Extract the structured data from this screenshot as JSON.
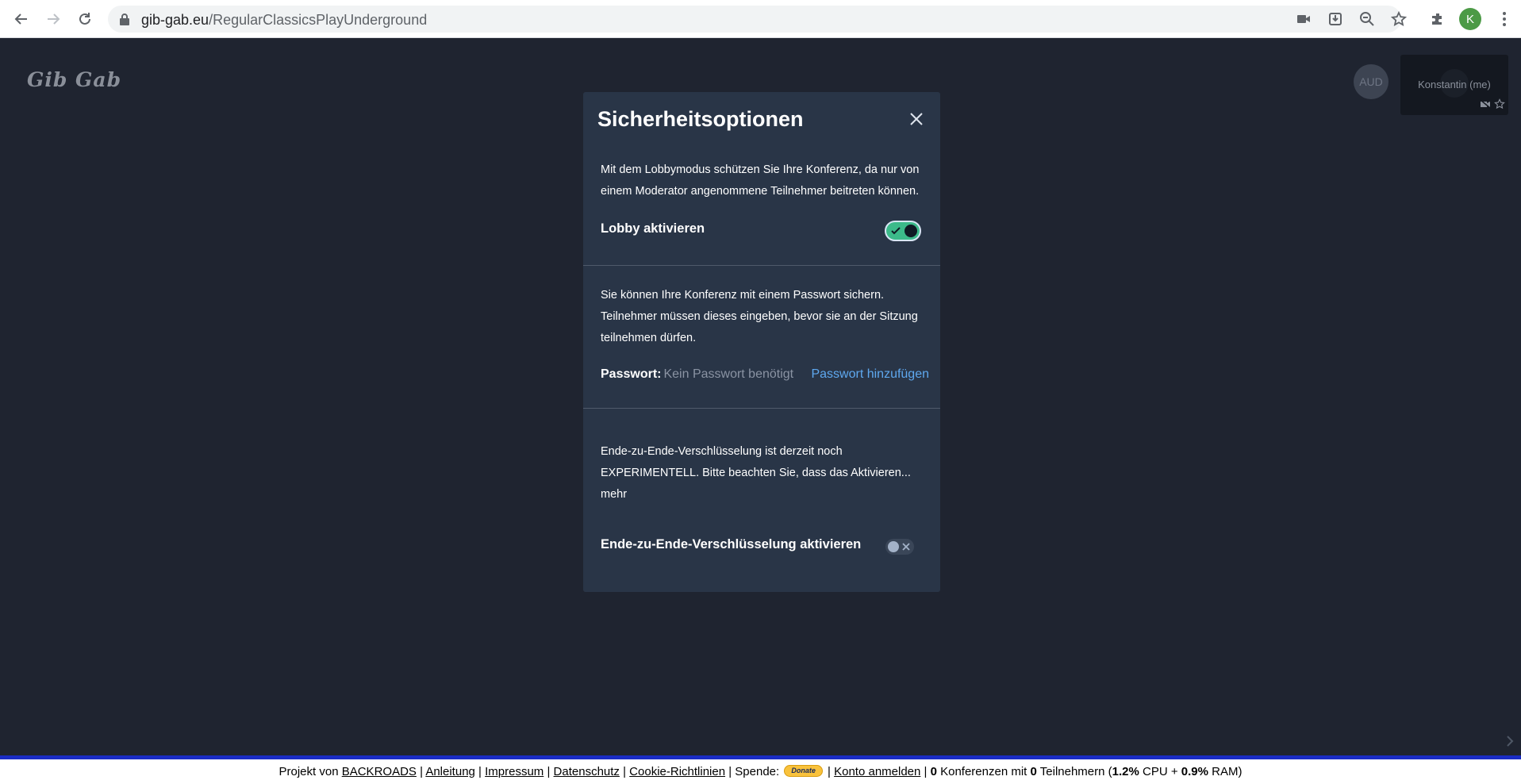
{
  "browser": {
    "url_domain": "gib-gab.eu",
    "url_path": "/RegularClassicsPlayUnderground",
    "profile_initial": "K"
  },
  "page": {
    "logo": "Gib Gab",
    "audience_avatar": "AUD",
    "self_tile_name": "Konstantin (me)"
  },
  "dialog": {
    "title": "Sicherheitsoptionen",
    "lobby": {
      "description": "Mit dem Lobbymodus schützen Sie Ihre Konferenz, da nur von einem Moderator angenommene Teilnehmer beitreten können.",
      "toggle_label": "Lobby aktivieren",
      "enabled": true
    },
    "password": {
      "description": "Sie können Ihre Konferenz mit einem Passwort sichern. Teilnehmer müssen dieses eingeben, bevor sie an der Sitzung teilnehmen dürfen.",
      "label": "Passwort:",
      "value": "Kein Passwort benötigt",
      "add_link": "Passwort hinzufügen"
    },
    "e2ee": {
      "description": "Ende-zu-Ende-Verschlüsselung ist derzeit noch EXPERIMENTELL. Bitte beachten Sie, dass das Aktivieren...",
      "more_link": "mehr",
      "toggle_label": "Ende-zu-Ende-Verschlüsselung aktivieren",
      "enabled": false
    }
  },
  "footer": {
    "prefix": "Projekt von",
    "backroads": "BACKROADS",
    "anleitung": "Anleitung",
    "impressum": "Impressum",
    "datenschutz": "Datenschutz",
    "cookie": "Cookie-Richtlinien",
    "spende": "Spende:",
    "donate": "Donate",
    "konto": "Konto anmelden",
    "conferences": "0",
    "conferences_text": "Konferenzen mit",
    "participants": "0",
    "participants_text": "Teilnehmern (",
    "cpu": "1.2%",
    "cpu_text": "CPU +",
    "ram": "0.9%",
    "ram_text": "RAM)"
  },
  "colors": {
    "background": "#1f2430",
    "dialog": "#293547",
    "toggle_on": "#3cba8a",
    "link": "#5ea8ef",
    "footer_line": "#1a2cc4"
  }
}
